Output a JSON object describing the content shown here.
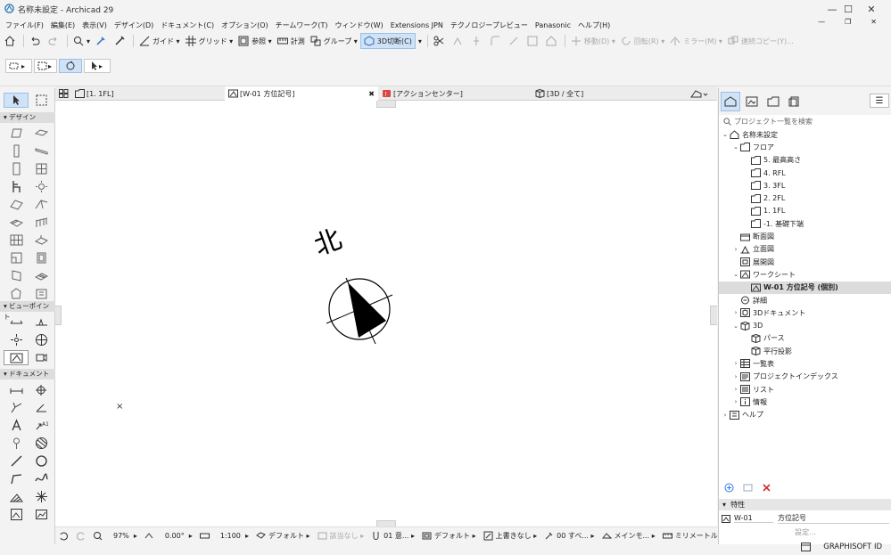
{
  "window": {
    "title": "名称未設定 - Archicad 29",
    "min": "—",
    "max": "☐",
    "close": "✕"
  },
  "menu": [
    "ファイル(F)",
    "編集(E)",
    "表示(V)",
    "デザイン(D)",
    "ドキュメント(C)",
    "オプション(O)",
    "チームワーク(T)",
    "ウィンドウ(W)",
    "Extensions JPN",
    "テクノロジープレビュー",
    "Panasonic",
    "ヘルプ(H)"
  ],
  "toolbar": {
    "guide": "ガイド",
    "grid": "グリッド",
    "ref": "参照",
    "measure": "計測",
    "group": "グループ",
    "cut3d": "3D切断(C)",
    "move": "移動(D)",
    "rotate": "回転(R)",
    "mirror": "ミラー(M)",
    "multicopy": "連続コピー(Y)..."
  },
  "toolbox": {
    "sec_design": "デザイン",
    "sec_viewpoint": "ビューポイント",
    "sec_document": "ドキュメント"
  },
  "tabs": [
    {
      "label": "[1. 1FL]"
    },
    {
      "label": "[W-01 方位記号]",
      "close": "✖"
    },
    {
      "label": "[アクションセンター]"
    },
    {
      "label": "[3D / 全て]"
    }
  ],
  "canvas": {
    "north_text": "北",
    "cross_mark": "×"
  },
  "status": {
    "zoom": "97%",
    "angle": "0.00°",
    "scale": "1:100",
    "pen": "デフォルト",
    "layer": "該当なし",
    "story": "01 意...",
    "model": "デフォルト",
    "override": "上書きなし",
    "reno": "00 すべ...",
    "main": "メインモ...",
    "unit": "ミリメートル"
  },
  "navigator": {
    "search_placeholder": "プロジェクト一覧を検索",
    "items": [
      {
        "label": "名称未設定",
        "indent": 0,
        "arrow": "⌄",
        "icon": "house"
      },
      {
        "label": "フロア",
        "indent": 1,
        "arrow": "⌄",
        "icon": "folder"
      },
      {
        "label": "5. 最高高さ",
        "indent": 2,
        "arrow": "",
        "icon": "floor"
      },
      {
        "label": "4. RFL",
        "indent": 2,
        "arrow": "",
        "icon": "floor"
      },
      {
        "label": "3. 3FL",
        "indent": 2,
        "arrow": "",
        "icon": "floor"
      },
      {
        "label": "2. 2FL",
        "indent": 2,
        "arrow": "",
        "icon": "floor"
      },
      {
        "label": "1. 1FL",
        "indent": 2,
        "arrow": "",
        "icon": "floor"
      },
      {
        "label": "-1. 基礎下端",
        "indent": 2,
        "arrow": "",
        "icon": "floor"
      },
      {
        "label": "断面図",
        "indent": 1,
        "arrow": "",
        "icon": "section"
      },
      {
        "label": "立面図",
        "indent": 1,
        "arrow": "›",
        "icon": "elev"
      },
      {
        "label": "展開図",
        "indent": 1,
        "arrow": "",
        "icon": "ie"
      },
      {
        "label": "ワークシート",
        "indent": 1,
        "arrow": "⌄",
        "icon": "ws"
      },
      {
        "label": "W-01 方位記号 (個別)",
        "indent": 2,
        "arrow": "",
        "icon": "ws",
        "selected": true
      },
      {
        "label": "詳細",
        "indent": 1,
        "arrow": "",
        "icon": "detail"
      },
      {
        "label": "3Dドキュメント",
        "indent": 1,
        "arrow": "›",
        "icon": "doc3d"
      },
      {
        "label": "3D",
        "indent": 1,
        "arrow": "⌄",
        "icon": "cube"
      },
      {
        "label": "パース",
        "indent": 2,
        "arrow": "",
        "icon": "cube"
      },
      {
        "label": "平行投影",
        "indent": 2,
        "arrow": "",
        "icon": "cube"
      },
      {
        "label": "一覧表",
        "indent": 1,
        "arrow": "›",
        "icon": "table"
      },
      {
        "label": "プロジェクトインデックス",
        "indent": 1,
        "arrow": "›",
        "icon": "index"
      },
      {
        "label": "リスト",
        "indent": 1,
        "arrow": "›",
        "icon": "list"
      },
      {
        "label": "情報",
        "indent": 1,
        "arrow": "›",
        "icon": "info"
      },
      {
        "label": "ヘルプ",
        "indent": 0,
        "arrow": "›",
        "icon": "help"
      }
    ],
    "properties_title": "特性",
    "prop_id": "W-01",
    "prop_name": "方位記号",
    "settings": "設定..."
  },
  "footer": {
    "brand": "GRAPHISOFT ID"
  },
  "colors": {
    "accent": "#cfe2f7",
    "delete": "#d32f2f",
    "add": "#2b7de9"
  }
}
